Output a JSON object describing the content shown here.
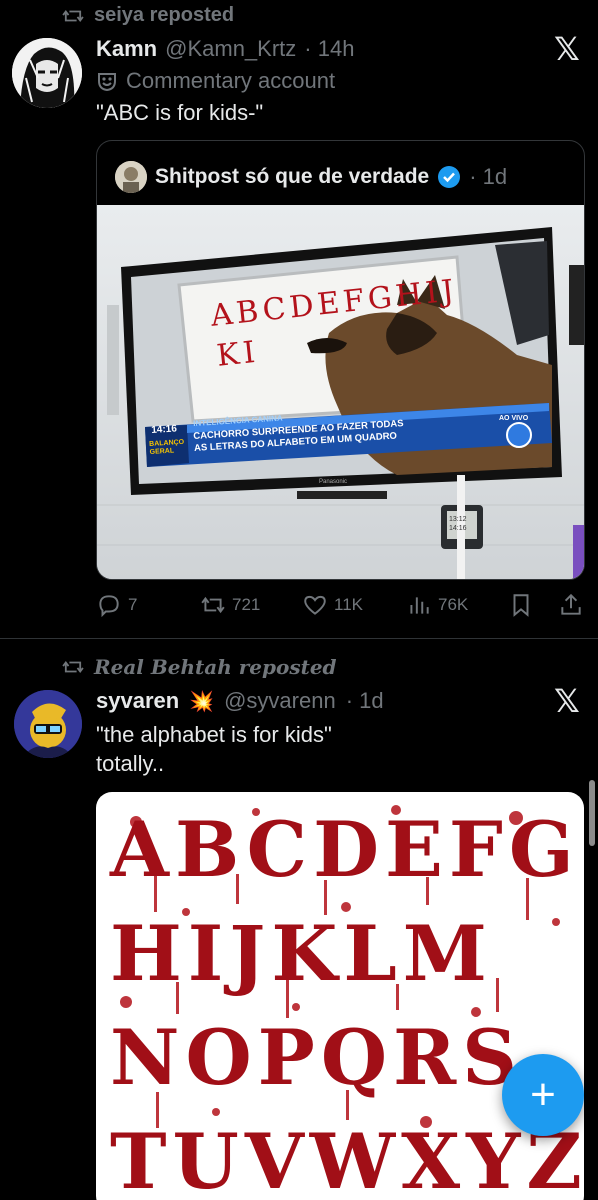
{
  "post1": {
    "repost_label": "seiya reposted",
    "name": "Kamn",
    "handle": "@Kamn_Krtz",
    "time": "· 14h",
    "badge": "Commentary account",
    "text": "\"ABC is for kids-\"",
    "quote": {
      "name": "Shitpost só que de verdade",
      "time": "· 1d",
      "tv": {
        "board_line1": "ABCDEFGHIJ",
        "board_line2": "KI",
        "time": "14:16",
        "program": "INTELIGÊNCIA CANINA",
        "headline1": "CACHORRO SURPREENDE AO FAZER TODAS",
        "headline2": "AS LETRAS DO ALFABETO EM UM QUADRO",
        "show1": "BALANÇO",
        "show2": "GERAL",
        "live": "AO VIVO",
        "brand": "Panasonic",
        "clock1": "13:12",
        "clock2": "14:16"
      }
    },
    "actions": {
      "replies": "7",
      "reposts": "721",
      "likes": "11K",
      "views": "76K"
    }
  },
  "post2": {
    "repost_label": "Real Behtah reposted",
    "name": "syvaren",
    "emoji": "💥",
    "handle": "@syvarenn",
    "time": "· 1d",
    "text_line1": "\"the alphabet is for kids\"",
    "text_line2": "totally..",
    "image_rows": [
      "ABCDEFG",
      "HIJKLM",
      "NOPQRS",
      "TUVWXYZ"
    ]
  },
  "colors": {
    "accent": "#1d9bf0",
    "blood": "#b3121b",
    "verified": "#1d9bf0",
    "explosion": "#f4511e"
  },
  "icons": {
    "repost": "repost-icon",
    "x_logo": "x-logo-icon",
    "reply": "reply-icon",
    "like": "heart-icon",
    "views": "views-icon",
    "bookmark": "bookmark-icon",
    "share": "share-icon",
    "compose": "plus-icon"
  }
}
